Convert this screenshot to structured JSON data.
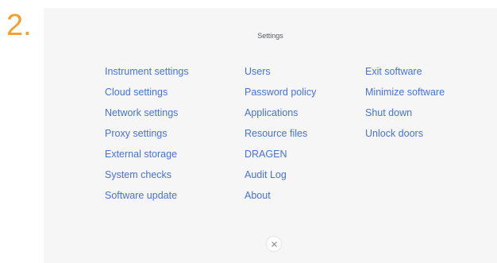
{
  "step_label": "2.",
  "settings_panel": {
    "title": "Settings",
    "columns": [
      {
        "items": [
          {
            "label": "Instrument settings"
          },
          {
            "label": "Cloud settings"
          },
          {
            "label": "Network settings"
          },
          {
            "label": "Proxy settings"
          },
          {
            "label": "External storage"
          },
          {
            "label": "System checks"
          },
          {
            "label": "Software update"
          }
        ]
      },
      {
        "items": [
          {
            "label": "Users"
          },
          {
            "label": "Password policy"
          },
          {
            "label": "Applications"
          },
          {
            "label": "Resource files"
          },
          {
            "label": "DRAGEN"
          },
          {
            "label": "Audit Log"
          },
          {
            "label": "About"
          }
        ]
      },
      {
        "items": [
          {
            "label": "Exit software"
          },
          {
            "label": "Minimize software"
          },
          {
            "label": "Shut down"
          },
          {
            "label": "Unlock doors"
          }
        ]
      }
    ],
    "close_icon": "close-icon"
  },
  "colors": {
    "step_label": "#f0a030",
    "link": "#4672d8",
    "panel_bg": "#f6f6f7",
    "title": "#555b63"
  }
}
